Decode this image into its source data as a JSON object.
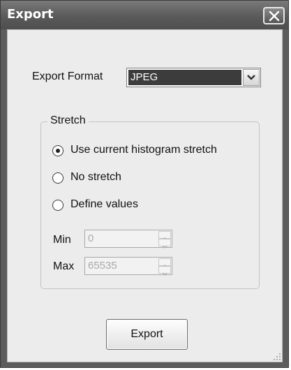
{
  "window": {
    "title": "Export",
    "close_icon": "close-icon"
  },
  "export_format": {
    "label": "Export Format",
    "selected": "JPEG"
  },
  "stretch": {
    "title": "Stretch",
    "options": [
      {
        "label": "Use current histogram stretch",
        "checked": true
      },
      {
        "label": "No stretch",
        "checked": false
      },
      {
        "label": "Define values",
        "checked": false
      }
    ],
    "min": {
      "label": "Min",
      "value": "0"
    },
    "max": {
      "label": "Max",
      "value": "65535"
    }
  },
  "buttons": {
    "export": "Export"
  },
  "colors": {
    "titlebar": "#5c5c5c",
    "dialog_bg": "#ececec",
    "selection": "#3c3c3c"
  }
}
